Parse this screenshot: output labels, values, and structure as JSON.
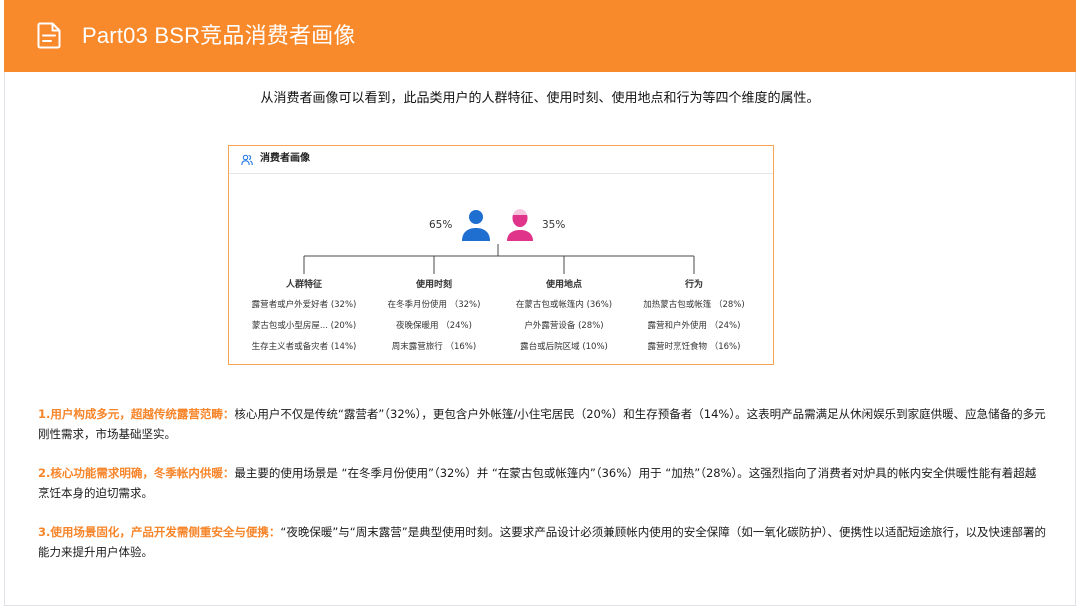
{
  "header": {
    "title": "Part03 BSR竞品消费者画像",
    "icon": "document-icon",
    "color": "#f98a2c"
  },
  "intro": "从消费者画像可以看到，此品类用户的人群特征、使用时刻、使用地点和行为等四个维度的属性。",
  "card": {
    "title": "消费者画像",
    "icon": "users-icon",
    "gender": {
      "male_pct": "65%",
      "female_pct": "35%",
      "male_share": 0.65,
      "female_share": 0.35,
      "male_color": "#1f6fd1",
      "female_color": "#e0338a"
    },
    "columns": [
      {
        "title": "人群特征",
        "items": [
          "露营者或户外爱好者 (32%)",
          "蒙古包或小型房屋... (20%)",
          "生存主义者或备灾者 (14%)"
        ]
      },
      {
        "title": "使用时刻",
        "items": [
          "在冬季月份使用 （32%)",
          "夜晚保暖用 （24%)",
          "周末露营旅行 （16%)"
        ]
      },
      {
        "title": "使用地点",
        "items": [
          "在蒙古包或帐篷内 (36%)",
          "户外露营设备 (28%)",
          "露台或后院区域 (10%)"
        ]
      },
      {
        "title": "行为",
        "items": [
          "加热蒙古包或帐篷 （28%)",
          "露营和户外使用 （24%)",
          "露营时烹饪食物 （16%)"
        ]
      }
    ]
  },
  "points": [
    {
      "lead": "1.用户构成多元，超越传统露营范畴：",
      "text": "核心用户不仅是传统“露营者”（32%），更包含户外帐篷/小住宅居民（20%）和生存预备者（14%）。这表明产品需满足从休闲娱乐到家庭供暖、应急储备的多元刚性需求，市场基础坚实。"
    },
    {
      "lead": "2.核心功能需求明确，冬季帐内供暖：",
      "text": "最主要的使用场景是 “在冬季月份使用”（32%）并 “在蒙古包或帐篷内”（36%）用于 “加热”（28%）。这强烈指向了消费者对炉具的帐内安全供暖性能有着超越烹饪本身的迫切需求。"
    },
    {
      "lead": "3.使用场景固化，产品开发需侧重安全与便携：",
      "text": "“夜晚保暖”与“周末露营”是典型使用时刻。这要求产品设计必须兼顾帐内使用的安全保障（如一氧化碳防护）、便携性以适配短途旅行，以及快速部署的能力来提升用户体验。"
    }
  ]
}
